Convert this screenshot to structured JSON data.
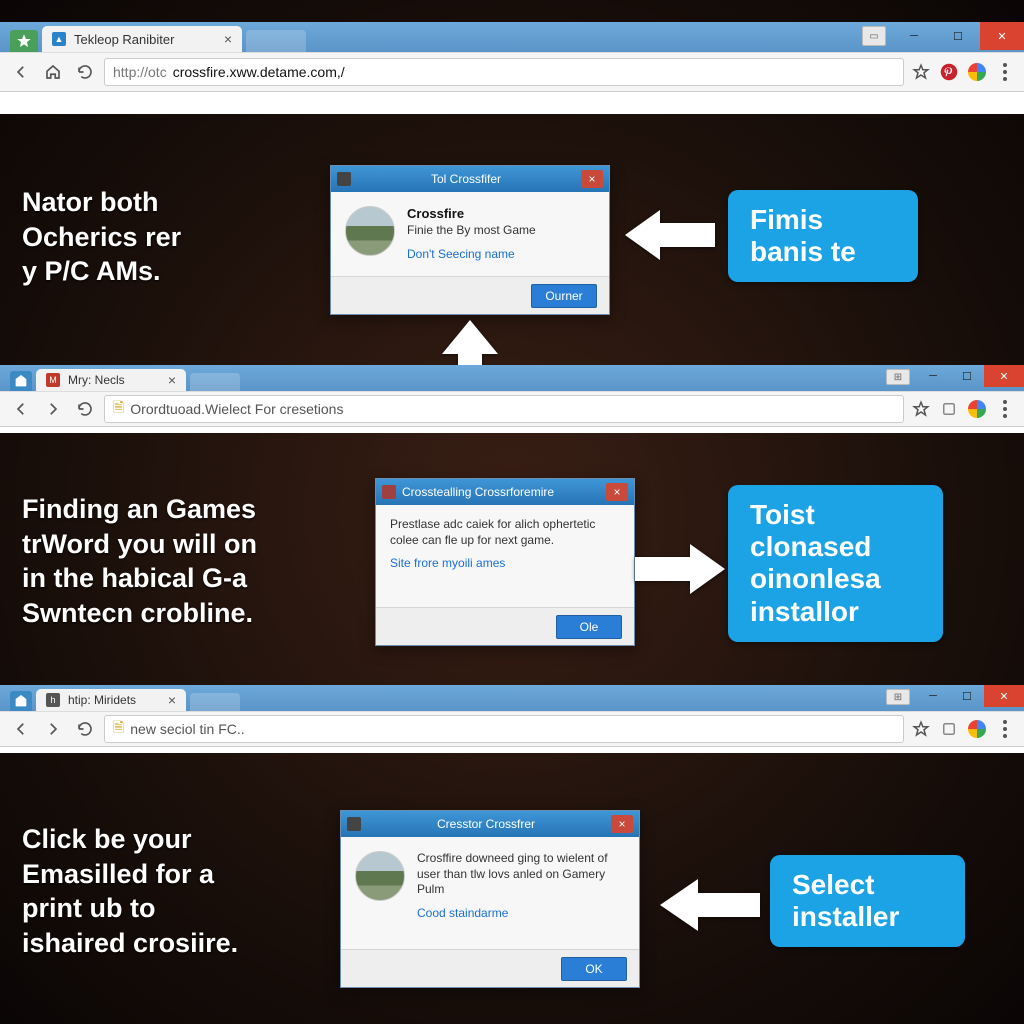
{
  "panel1": {
    "tab_title": "Tekleop Ranibiter",
    "url_scheme": "http://otc",
    "url_rest": " crossfire.xww.detame.com,/",
    "side_text": "Nator both\nOcherics rer\ny P/C AMs.",
    "dialog": {
      "title": "Tol Crossfifer",
      "heading": "Crossfire",
      "body": "Finie the By most Game",
      "link": "Don't Seecing name",
      "ok": "Ourner"
    },
    "callout": "Fimis\nbanis te"
  },
  "panel2": {
    "tab_title": "Mry: Necls",
    "omnibox": "Orordtuoad.Wielect For cresetions",
    "side_text": "Finding an Games\ntrWord you will on\nin the habical G-a\nSwntecn crobline.",
    "dialog": {
      "title": "Crosstealling Crossrforemire",
      "body": "Prestlase adc caiek for alich ophertetic colee can fle up for next game.",
      "link": "Site frore myoili ames",
      "ok": "Ole"
    },
    "callout": "Toist\nclonased\noinonlesa\ninstallor"
  },
  "panel3": {
    "tab_title": "htip: Miridets",
    "omnibox": "new seciol tin FC..",
    "side_text": "Click be your\nEmasilled for a\nprint ub to\nishaired crosiire.",
    "dialog": {
      "title": "Cresstor Crossfrer",
      "body": "Crosffire downeed ging to wielent of user than tlw lovs anled on Gamery Pulm",
      "link": "Cood staindarme",
      "ok": "OK"
    },
    "callout": "Select\ninstaller"
  },
  "icons": {
    "star": "★",
    "page": "🗎"
  }
}
